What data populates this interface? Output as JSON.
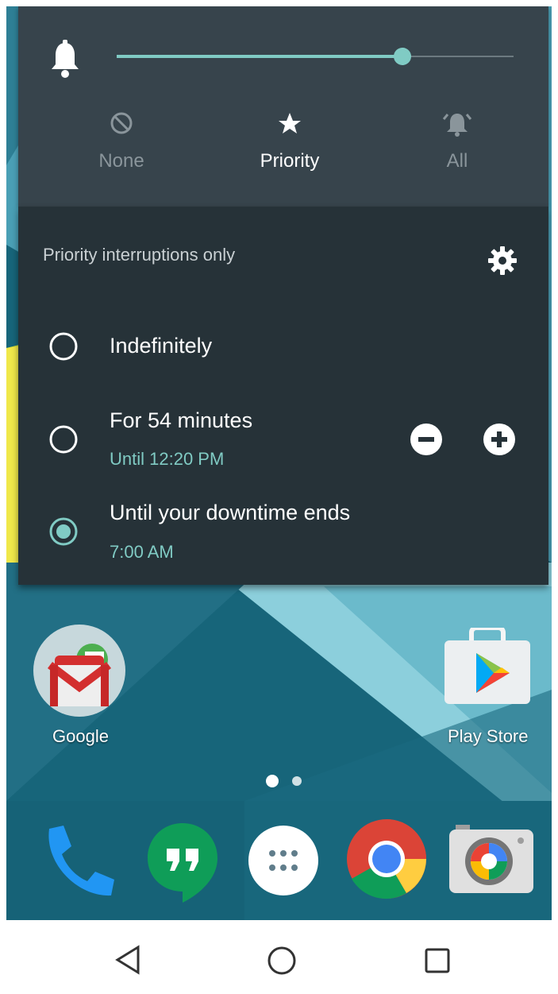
{
  "volume": {
    "level": 0.72
  },
  "modes": [
    {
      "label": "None",
      "icon": "block-icon",
      "active": false
    },
    {
      "label": "Priority",
      "icon": "star-icon",
      "active": true
    },
    {
      "label": "All",
      "icon": "ringing-bell-icon",
      "active": false
    }
  ],
  "dnd": {
    "title": "Priority interruptions only",
    "options": [
      {
        "title": "Indefinitely",
        "subtitle": "",
        "selected": false
      },
      {
        "title": "For 54 minutes",
        "subtitle": "Until 12:20 PM",
        "selected": false
      },
      {
        "title": "Until your downtime ends",
        "subtitle": "7:00 AM",
        "selected": true
      }
    ]
  },
  "home": {
    "apps": [
      {
        "label": "Google",
        "icon": "gmail-folder-icon"
      },
      {
        "label": "Play Store",
        "icon": "play-store-icon"
      }
    ],
    "page_indicator": {
      "pages": 2,
      "current": 1
    },
    "dock": [
      "phone-icon",
      "hangouts-icon",
      "app-drawer-icon",
      "chrome-icon",
      "camera-icon"
    ]
  },
  "navbar": [
    "back-icon",
    "home-icon",
    "recents-icon"
  ],
  "colors": {
    "accent": "#80cbc4",
    "panel_top": "#37444c",
    "panel": "#263238"
  }
}
